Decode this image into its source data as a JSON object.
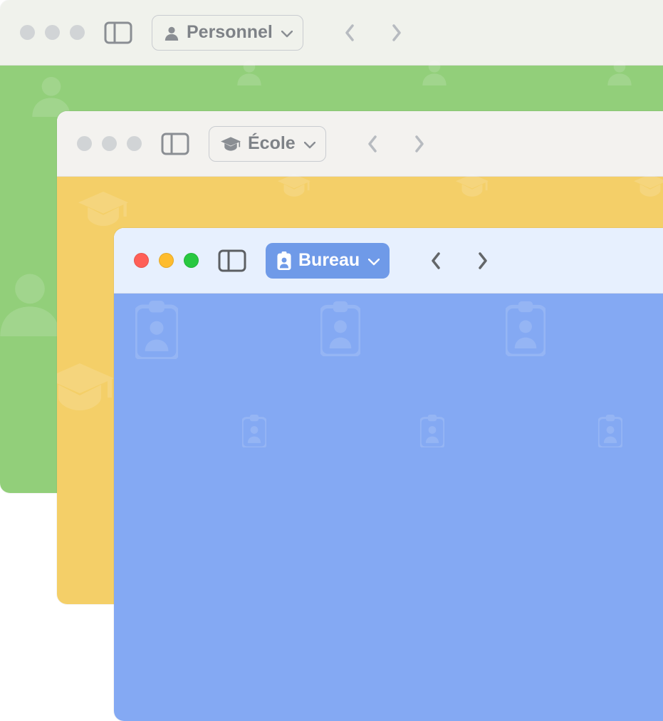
{
  "windows": [
    {
      "label": "Personnel",
      "icon": "person-icon",
      "active": false,
      "theme": "green"
    },
    {
      "label": "École",
      "icon": "graduation-cap-icon",
      "active": false,
      "theme": "yellow"
    },
    {
      "label": "Bureau",
      "icon": "badge-icon",
      "active": true,
      "theme": "blue"
    }
  ]
}
